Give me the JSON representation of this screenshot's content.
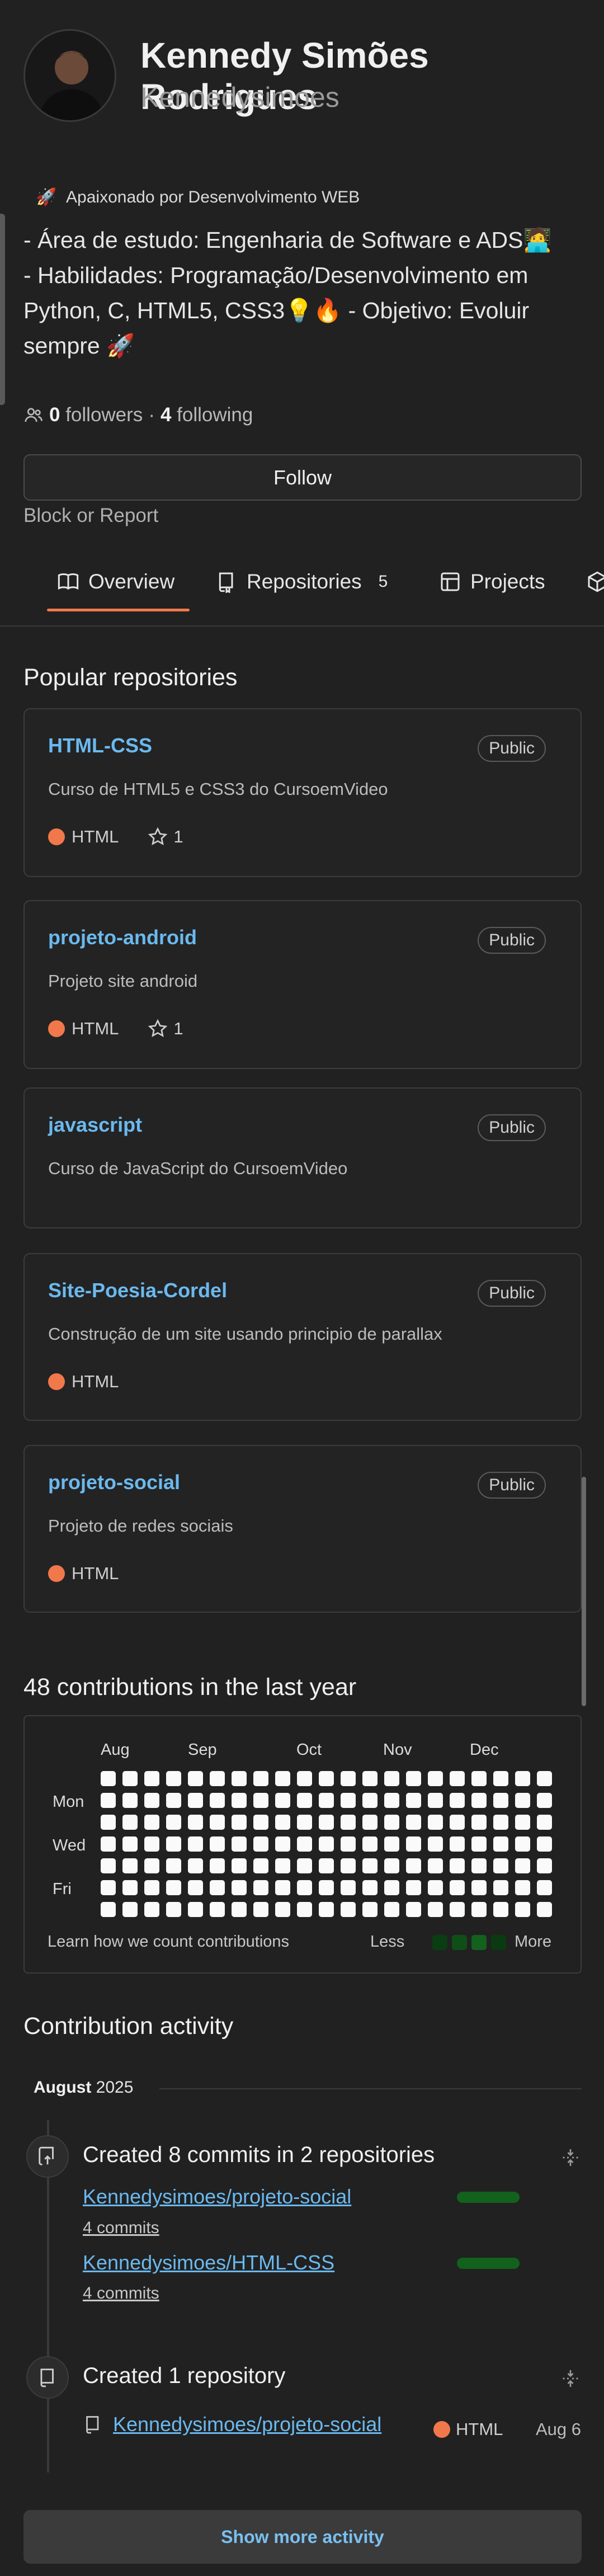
{
  "profile": {
    "name": "Kennedy Simões Rodrigues",
    "username": "Kennedysimoes",
    "status": "Apaixonado por Desenvolvimento WEB",
    "bio": "- Área de estudo: Engenharia de Software e ADS🧑‍💻\n- Habilidades: Programação/Desenvolvimento em Python, C, HTML5, CSS3💡🔥 - Objetivo: Evoluir sempre 🚀",
    "followers_count": "0",
    "followers_label": "followers",
    "separator": "·",
    "following_count": "4",
    "following_label": "following",
    "follow_button": "Follow",
    "block_report": "Block or Report"
  },
  "tabs": [
    {
      "label": "Overview",
      "icon": "book-icon",
      "active": true
    },
    {
      "label": "Repositories",
      "icon": "repo-icon",
      "count": "5"
    },
    {
      "label": "Projects",
      "icon": "table-icon"
    }
  ],
  "popular": {
    "title": "Popular repositories",
    "repos": [
      {
        "name": "HTML-CSS",
        "visibility": "Public",
        "description": "Curso de HTML5 e CSS3 do CursoemVideo",
        "language": "HTML",
        "stars": "1"
      },
      {
        "name": "projeto-android",
        "visibility": "Public",
        "description": "Projeto site android",
        "language": "HTML",
        "stars": "1"
      },
      {
        "name": "javascript",
        "visibility": "Public",
        "description": "Curso de JavaScript do CursoemVideo"
      },
      {
        "name": "Site-Poesia-Cordel",
        "visibility": "Public",
        "description": "Construção de um site usando principio de parallax",
        "language": "HTML"
      },
      {
        "name": "projeto-social",
        "visibility": "Public",
        "description": "Projeto de redes sociais",
        "language": "HTML"
      }
    ]
  },
  "contributions": {
    "title": "48 contributions in the last year",
    "months": [
      "Aug",
      "Sep",
      "Oct",
      "Nov",
      "Dec"
    ],
    "days": [
      "Mon",
      "Wed",
      "Fri"
    ],
    "learn": "Learn how we count contributions",
    "less": "Less",
    "more": "More"
  },
  "activity": {
    "title": "Contribution activity",
    "month": "August",
    "year": "2025",
    "commits_title": "Created 8 commits in 2 repositories",
    "commit_repos": [
      {
        "repo": "Kennedysimoes/projeto-social",
        "commits": "4 commits"
      },
      {
        "repo": "Kennedysimoes/HTML-CSS",
        "commits": "4 commits"
      }
    ],
    "created_title": "Created 1 repository",
    "created_repo": "Kennedysimoes/projeto-social",
    "created_language": "HTML",
    "created_date": "Aug 6",
    "show_more": "Show more activity"
  },
  "colors": {
    "accent_orange": "#f07a4b",
    "link_blue": "#6bb9ee",
    "commit_bar_green": "#12611c"
  }
}
